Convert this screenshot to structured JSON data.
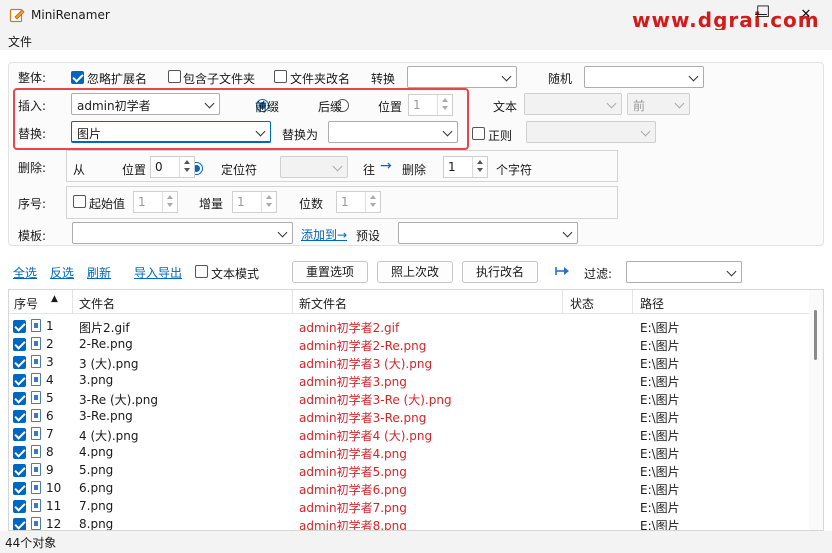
{
  "window": {
    "title": "MiniRenamer",
    "watermark": "www.dgrai.com",
    "min_btn": "—",
    "max_btn": "☐",
    "close_btn": "✕"
  },
  "menu": {
    "file": "文件"
  },
  "overall": {
    "label": "整体:",
    "ignore_ext": "忽略扩展名",
    "include_subfolders": "包含子文件夹",
    "rename_folders": "文件夹改名",
    "convert_label": "转换",
    "random_label": "随机"
  },
  "insert": {
    "label": "插入:",
    "value": "admin初学者",
    "prefix": "前缀",
    "suffix": "后缀",
    "position": "位置",
    "position_value": "1",
    "text_label": "文本",
    "text_pos_value": "前"
  },
  "replace": {
    "label": "替换:",
    "value": "图片",
    "replace_with_label": "替换为",
    "replace_with_value": "",
    "regex": "正则"
  },
  "delete": {
    "label": "删除:",
    "from": "从",
    "position": "位置",
    "position_value": "0",
    "locator": "定位符",
    "towards": "往",
    "arrow": "→",
    "delete_label": "删除",
    "count_value": "1",
    "chars_label": "个字符"
  },
  "sequence": {
    "label": "序号:",
    "start_label": "起始值",
    "start_value": "1",
    "increment_label": "增量",
    "increment_value": "1",
    "digits_label": "位数",
    "digits_value": "1"
  },
  "template": {
    "label": "模板:",
    "add_to": "添加到→",
    "preset_label": "预设"
  },
  "toolbar": {
    "select_all": "全选",
    "invert": "反选",
    "refresh": "刷新",
    "import_export": "导入导出",
    "text_mode": "文本模式",
    "reset": "重置选项",
    "same_as_last": "照上次改",
    "execute": "执行改名",
    "filter_label": "过滤:"
  },
  "table": {
    "headers": {
      "seq": "序号",
      "sort_icon": "▲",
      "filename": "文件名",
      "newname": "新文件名",
      "status": "状态",
      "path": "路径"
    },
    "rows": [
      {
        "seq": "1",
        "name": "图片2.gif",
        "new": "admin初学者2.gif",
        "status": "",
        "path": "E:\\图片"
      },
      {
        "seq": "2",
        "name": "2-Re.png",
        "new": "admin初学者2-Re.png",
        "status": "",
        "path": "E:\\图片"
      },
      {
        "seq": "3",
        "name": "3 (大).png",
        "new": "admin初学者3 (大).png",
        "status": "",
        "path": "E:\\图片"
      },
      {
        "seq": "4",
        "name": "3.png",
        "new": "admin初学者3.png",
        "status": "",
        "path": "E:\\图片"
      },
      {
        "seq": "5",
        "name": "3-Re (大).png",
        "new": "admin初学者3-Re (大).png",
        "status": "",
        "path": "E:\\图片"
      },
      {
        "seq": "6",
        "name": "3-Re.png",
        "new": "admin初学者3-Re.png",
        "status": "",
        "path": "E:\\图片"
      },
      {
        "seq": "7",
        "name": "4 (大).png",
        "new": "admin初学者4 (大).png",
        "status": "",
        "path": "E:\\图片"
      },
      {
        "seq": "8",
        "name": "4.png",
        "new": "admin初学者4.png",
        "status": "",
        "path": "E:\\图片"
      },
      {
        "seq": "9",
        "name": "5.png",
        "new": "admin初学者5.png",
        "status": "",
        "path": "E:\\图片"
      },
      {
        "seq": "10",
        "name": "6.png",
        "new": "admin初学者6.png",
        "status": "",
        "path": "E:\\图片"
      },
      {
        "seq": "11",
        "name": "7.png",
        "new": "admin初学者7.png",
        "status": "",
        "path": "E:\\图片"
      },
      {
        "seq": "12",
        "name": "8.png",
        "new": "admin初学者8.png",
        "status": "",
        "path": "E:\\图片"
      }
    ]
  },
  "status": {
    "count": "44个对象"
  },
  "colors": {
    "accent": "#0067c0",
    "highlight": "#e8474a",
    "newname": "#d8232a"
  }
}
